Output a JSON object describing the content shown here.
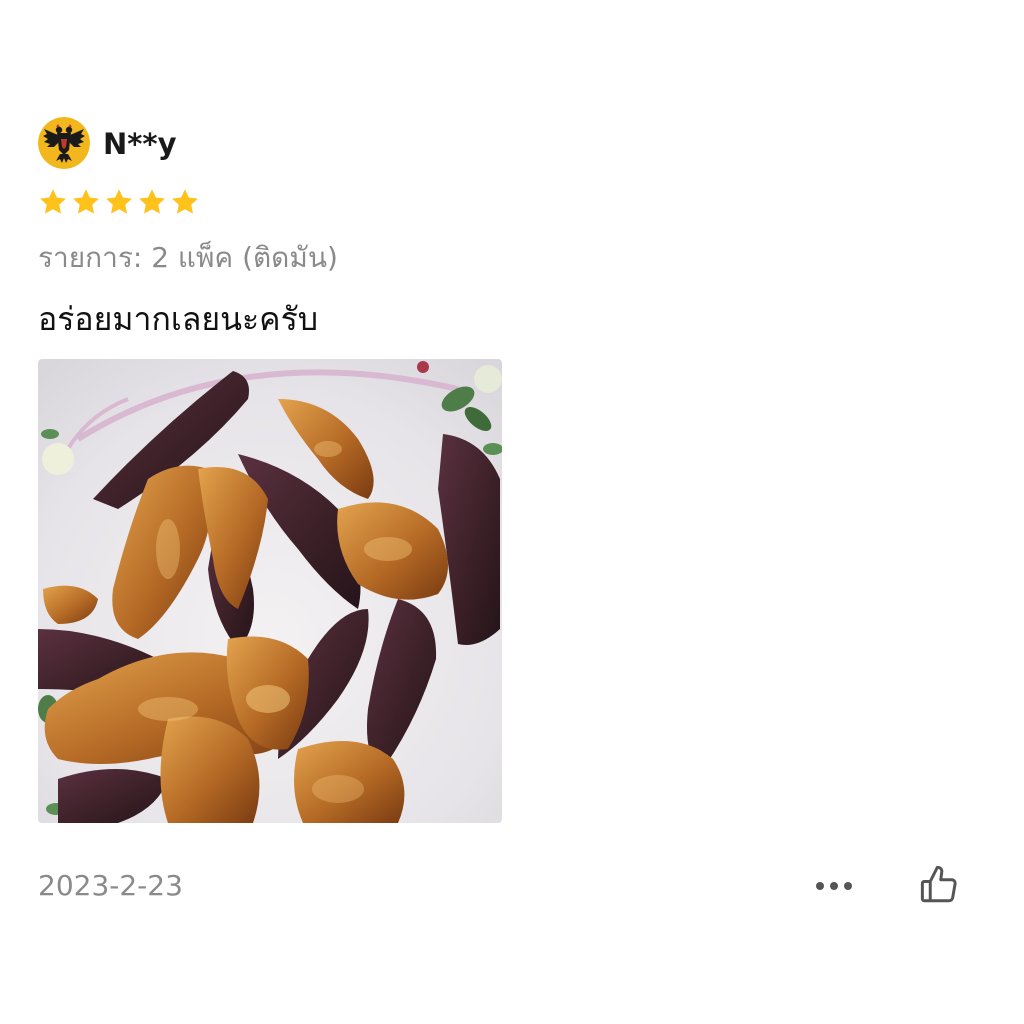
{
  "review": {
    "username": "N**y",
    "rating": 5,
    "rating_max": 5,
    "variant_text": "รายการ: 2 แพ็ค (ติดมัน)",
    "comment": "อร่อยมากเลยนะครับ",
    "date": "2023-2-23",
    "avatar_icon": "eagle-crest-icon",
    "photo_subject": "fried-pork-photo",
    "more_icon": "more-dots-icon",
    "like_icon": "thumbs-up-icon"
  },
  "colors": {
    "star": "#FFC21A",
    "muted_text": "#8A8A8A",
    "primary_text": "#111111",
    "avatar_bg": "#F4B400"
  }
}
